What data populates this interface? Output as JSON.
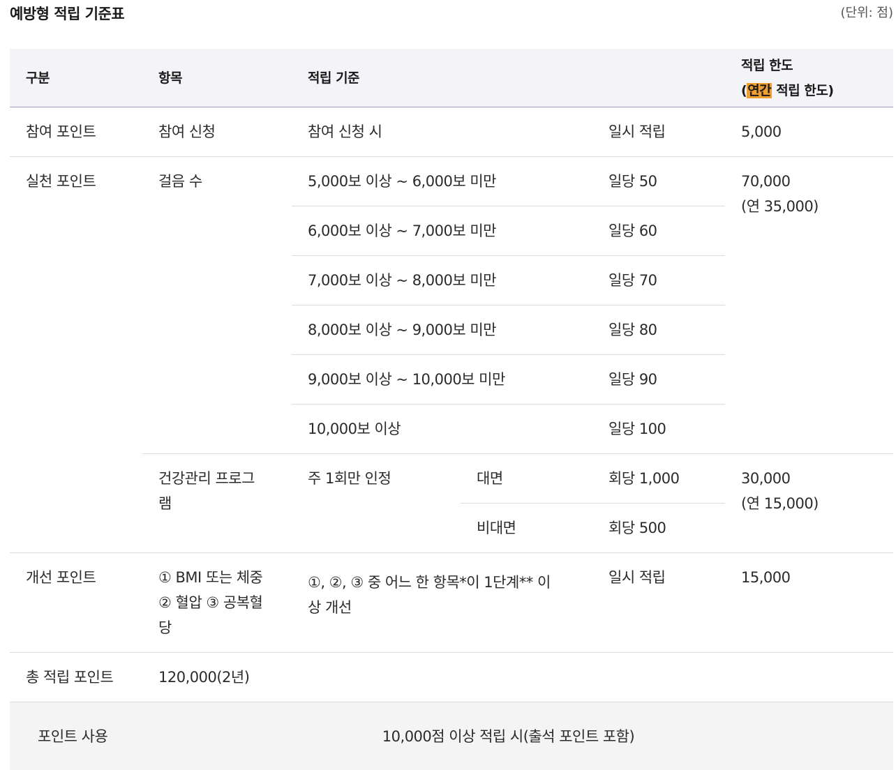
{
  "title": "예방형 적립 기준표",
  "unit": "(단위: 점)",
  "header": {
    "category": "구분",
    "item": "항목",
    "criteria": "적립 기준",
    "limit_line1": "적립 한도",
    "limit_paren_open": "(",
    "limit_highlight": "연간",
    "limit_rest": " 적립 한도)"
  },
  "rows": {
    "participation": {
      "category": "참여 포인트",
      "item": "참여 신청",
      "criteria": "참여 신청 시",
      "value": "일시 적립",
      "limit": "5,000"
    },
    "practice": {
      "category": "실천 포인트",
      "steps_item": "걸음 수",
      "steps_limit_line1": "70,000",
      "steps_limit_line2": "(연 35,000)",
      "steps": [
        {
          "criteria": "5,000보 이상 ~ 6,000보 미만",
          "value": "일당 50"
        },
        {
          "criteria": "6,000보 이상 ~ 7,000보 미만",
          "value": "일당 60"
        },
        {
          "criteria": "7,000보 이상 ~ 8,000보 미만",
          "value": "일당 70"
        },
        {
          "criteria": "8,000보 이상 ~ 9,000보 미만",
          "value": "일당 80"
        },
        {
          "criteria": "9,000보 이상 ~ 10,000보 미만",
          "value": "일당 90"
        },
        {
          "criteria": "10,000보 이상",
          "value": "일당 100"
        }
      ],
      "program_item_line1": "건강관리 프로그",
      "program_item_line2": "램",
      "program_criteria": "주 1회만 인정",
      "program_limit_line1": "30,000",
      "program_limit_line2": "(연 15,000)",
      "program_modes": [
        {
          "mode": "대면",
          "value": "회당 1,000"
        },
        {
          "mode": "비대면",
          "value": "회당 500"
        }
      ]
    },
    "improvement": {
      "category": "개선 포인트",
      "item_line1": "① BMI 또는 체중",
      "item_line2": "② 혈압 ③ 공복혈",
      "item_line3": "당",
      "criteria_line1": "①, ②, ③ 중 어느 한 항목*이 1단계** 이",
      "criteria_line2": "상 개선",
      "value": "일시 적립",
      "limit": "15,000"
    },
    "total": {
      "category": "총 적립 포인트",
      "value": "120,000(2년)"
    }
  },
  "footer": {
    "label": "포인트 사용",
    "value": "10,000점 이상 적립 시(출석 포인트 포함)"
  }
}
